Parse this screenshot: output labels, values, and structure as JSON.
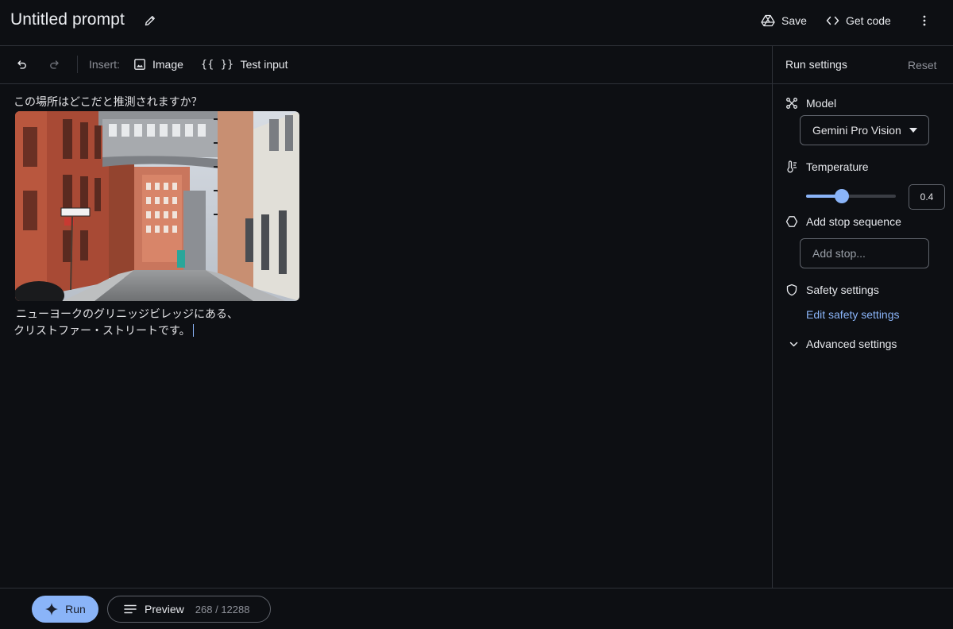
{
  "header": {
    "title": "Untitled prompt",
    "save_label": "Save",
    "get_code_label": "Get code"
  },
  "toolbar": {
    "insert_label": "Insert:",
    "image_label": "Image",
    "test_input_label": "Test input",
    "test_input_glyph": "{{ }}"
  },
  "prompt": {
    "question": "この場所はどこだと推測されますか？",
    "answer_line1": "ニューヨークのグリニッジビレッジにある、",
    "answer_line2": "クリストファー・ストリートです。"
  },
  "sidebar": {
    "title": "Run settings",
    "reset_label": "Reset",
    "model_label": "Model",
    "model_value": "Gemini Pro Vision",
    "temperature_label": "Temperature",
    "temperature_value": "0.4",
    "temperature_fraction": 0.4,
    "stop_label": "Add stop sequence",
    "stop_placeholder": "Add stop...",
    "safety_label": "Safety settings",
    "safety_link": "Edit safety settings",
    "advanced_label": "Advanced settings"
  },
  "footer": {
    "run_label": "Run",
    "preview_label": "Preview",
    "token_count": "268 / 12288"
  },
  "colors": {
    "background": "#0d0f13",
    "accent": "#8ab4f8",
    "divider": "#2e3138"
  }
}
